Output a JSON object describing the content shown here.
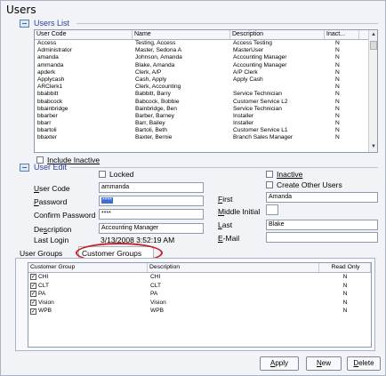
{
  "window": {
    "title": "Users"
  },
  "users_list": {
    "section_title": "Users List",
    "columns": [
      "User Code",
      "Name",
      "Description",
      "Inact..."
    ],
    "rows": [
      [
        "Access",
        "Testing, Access",
        "Access Testing",
        "N"
      ],
      [
        "Administrator",
        "Master, Sedona A",
        "MasterUser",
        "N"
      ],
      [
        "amanda",
        "Johnson, Amanda",
        "Accounting Manager",
        "N"
      ],
      [
        "ammanda",
        "Blake, Amanda",
        "Accounting Manager",
        "N"
      ],
      [
        "apderk",
        "Clerk, A/P",
        "A/P Clerk",
        "N"
      ],
      [
        "Applycash",
        "Cash, Apply",
        "Apply Cash",
        "N"
      ],
      [
        "ARClerk1",
        "Clerk, Accounting",
        "",
        "N"
      ],
      [
        "bbabbitt",
        "Babbitt, Barry",
        "Service Technician",
        "N"
      ],
      [
        "bbabcock",
        "Babcock, Bobbie",
        "Customer Service L2",
        "N"
      ],
      [
        "bbainbridge",
        "Bainbridge, Ben",
        "Service Technician",
        "N"
      ],
      [
        "bbarber",
        "Barber, Barney",
        "Installer",
        "N"
      ],
      [
        "bbarr",
        "Barr, Bailey",
        "Installer",
        "N"
      ],
      [
        "bbartoli",
        "Bartoli, Beth",
        "Customer Service L1",
        "N"
      ],
      [
        "bbaxter",
        "Baxter, Bernie",
        "Branch Sales Manager",
        "N"
      ]
    ],
    "include_inactive_label": "Include Inactive"
  },
  "user_edit": {
    "section_title": "User Edit",
    "locked_label": "Locked",
    "inactive_label": "Inactive",
    "create_other_users_label": "Create Other Users",
    "user_code_label": "User Code",
    "user_code_value": "ammanda",
    "password_label": "Password",
    "password_value": "****",
    "confirm_password_label": "Confirm Password",
    "confirm_password_value": "****",
    "description_label": "Description",
    "description_value": "Accounting Manager",
    "last_login_label": "Last Login",
    "last_login_value": "3/13/2008 3:52:19 AM",
    "first_label": "First",
    "first_value": "Amanda",
    "middle_initial_label": "Middle Initial",
    "middle_initial_value": "",
    "last_label": "Last",
    "last_value": "Blake",
    "email_label": "E-Mail",
    "email_value": ""
  },
  "tabs": {
    "user_groups": "User Groups",
    "customer_groups": "Customer Groups"
  },
  "customer_groups": {
    "columns": [
      "Customer Group",
      "Description",
      "Read Only"
    ],
    "rows": [
      [
        "CHI",
        "CHI",
        "N"
      ],
      [
        "CLT",
        "CLT",
        "N"
      ],
      [
        "PA",
        "PA",
        "N"
      ],
      [
        "Vision",
        "Vision",
        "N"
      ],
      [
        "WPB",
        "WPB",
        "N"
      ]
    ]
  },
  "buttons": {
    "apply": "Apply",
    "new": "New",
    "delete": "Delete"
  },
  "colors": {
    "highlight": "#c8202a",
    "section_title": "#2c3e9e",
    "selection": "#3a6fd8"
  }
}
